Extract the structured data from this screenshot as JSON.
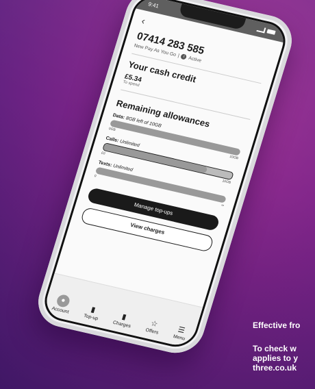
{
  "status_bar": {
    "time": "9:41"
  },
  "account": {
    "number": "07414 283 585",
    "plan": "New Pay As You Go",
    "status": "Active"
  },
  "credit": {
    "heading": "Your cash credit",
    "amount": "£5.34",
    "sublabel": "To spend"
  },
  "allowances": {
    "heading": "Remaining allowances",
    "data": {
      "label": "Data:",
      "value": "8GB left of 10GB",
      "min": "0GB",
      "max": "10GB",
      "fraction": 0.8
    },
    "calls": {
      "label": "Calls:",
      "value": "Unlimited",
      "min": "£0",
      "max": ""
    },
    "texts": {
      "label": "Texts:",
      "value": "Unlimited",
      "min": "0",
      "max": "∞"
    },
    "extra_end": "∞"
  },
  "buttons": {
    "manage": "Manage top-ups",
    "view": "View charges"
  },
  "tabbar": {
    "account": "Account",
    "topup": "Top-up",
    "charges": "Charges",
    "offers": "Offers",
    "menu": "Menu"
  },
  "side_text": {
    "line1": "Effective fro",
    "line2": "To check w",
    "line3": "applies to y",
    "line4": "three.co.uk"
  }
}
